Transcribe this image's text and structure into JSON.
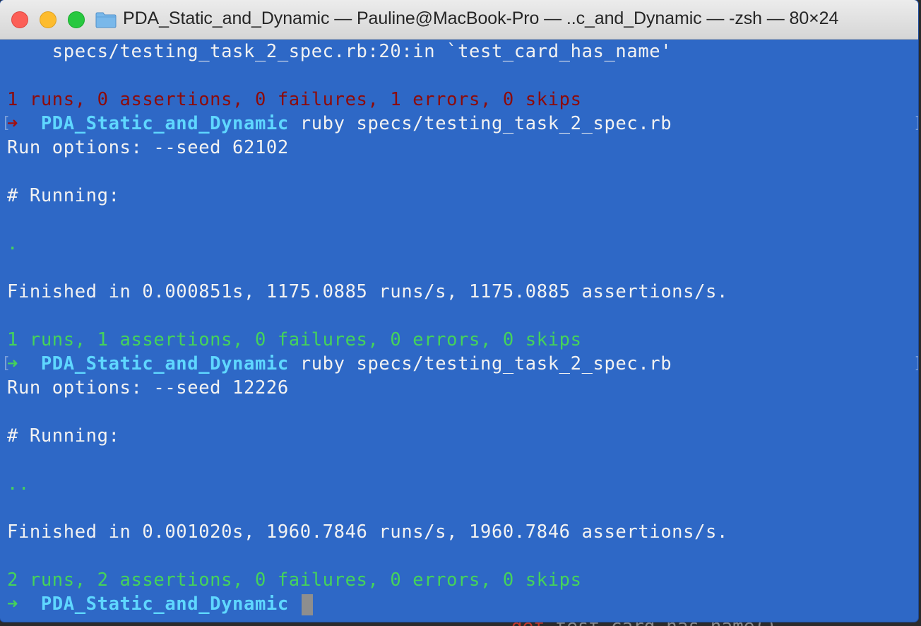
{
  "window": {
    "title": "PDA_Static_and_Dynamic — Pauline@MacBook-Pro — ..c_and_Dynamic — -zsh — 80×24"
  },
  "background_editor": {
    "code_keyword": "def",
    "code_text": " test_card_has_name()"
  },
  "terminal": {
    "trace_line": "    specs/testing_task_2_spec.rb:20:in `test_card_has_name'",
    "run1": {
      "summary": "1 runs, 0 assertions, 0 failures, 1 errors, 0 skips"
    },
    "prompt": {
      "arrow": "➜",
      "directory": "PDA_Static_and_Dynamic",
      "command": "ruby specs/testing_task_2_spec.rb"
    },
    "run2": {
      "options": "Run options: --seed 62102",
      "running": "# Running:",
      "progress": ".",
      "finished": "Finished in 0.000851s, 1175.0885 runs/s, 1175.0885 assertions/s.",
      "summary": "1 runs, 1 assertions, 0 failures, 0 errors, 0 skips"
    },
    "run3": {
      "options": "Run options: --seed 12226",
      "running": "# Running:",
      "progress": "..",
      "finished": "Finished in 0.001020s, 1960.7846 runs/s, 1960.7846 assertions/s.",
      "summary": "2 runs, 2 assertions, 0 failures, 0 errors, 0 skips"
    },
    "colors": {
      "background": "#2e68c6",
      "error": "#8c0b0b",
      "success": "#45d35a",
      "directory": "#5fd7ff"
    }
  }
}
